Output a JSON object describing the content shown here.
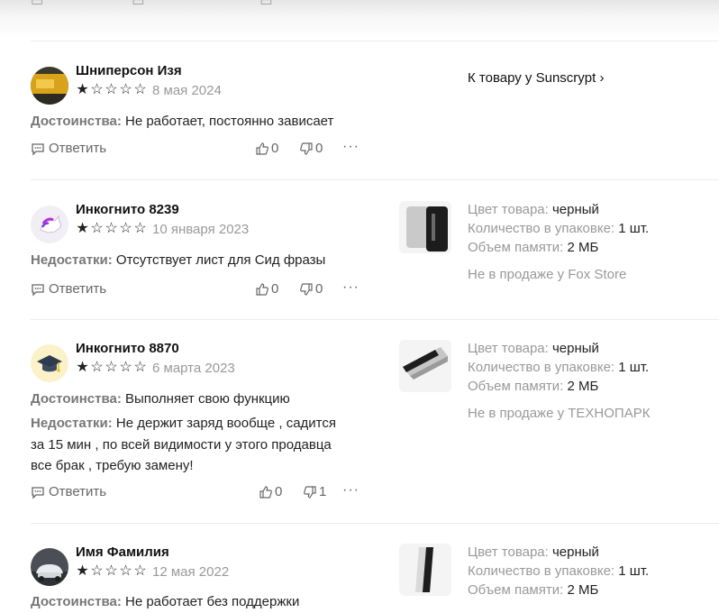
{
  "reviews": [
    {
      "author": "Шниперсон Изя",
      "date": "8 мая 2024",
      "rating": 1,
      "lines": [
        {
          "label": "Достоинства:",
          "text": " Не работает, постоянно зависает"
        }
      ],
      "reply": "Ответить",
      "likes": "0",
      "dislikes": "0",
      "more": "···",
      "product_link": "К товару у Sunscrypt ›"
    },
    {
      "author": "Инкогнито 8239",
      "date": "10 января 2023",
      "rating": 1,
      "lines": [
        {
          "label": "Недостатки:",
          "text": " Отсутствует лист для Сид фразы"
        }
      ],
      "reply": "Ответить",
      "likes": "0",
      "dislikes": "0",
      "more": "···",
      "product": {
        "color_label": "Цвет товара:",
        "color": " черный",
        "qty_label": "Количество в упаковке:",
        "qty": " 1 шт.",
        "mem_label": "Объем памяти:",
        "mem": " 2 МБ",
        "note": "Не в продаже у Fox Store"
      }
    },
    {
      "author": "Инкогнито 8870",
      "date": "6 марта 2023",
      "rating": 1,
      "lines": [
        {
          "label": "Достоинства:",
          "text": " Выполняет свою функцию"
        },
        {
          "label": "Недостатки:",
          "text": " Не держит заряд вообще , садится"
        },
        {
          "label": "",
          "text": "за 15 мин , по всей видимости у этого продавца"
        },
        {
          "label": "",
          "text": "все брак , требую замену!"
        }
      ],
      "reply": "Ответить",
      "likes": "0",
      "dislikes": "1",
      "more": "···",
      "product": {
        "color_label": "Цвет товара:",
        "color": " черный",
        "qty_label": "Количество в упаковке:",
        "qty": " 1 шт.",
        "mem_label": "Объем памяти:",
        "mem": " 2 МБ",
        "note": "Не в продаже у ТЕХНОПАРК"
      }
    },
    {
      "author": "Имя Фамилия",
      "date": "12 мая 2022",
      "rating": 1,
      "lines": [
        {
          "label": "Достоинства:",
          "text": " Не работает без поддержки"
        }
      ],
      "product": {
        "color_label": "Цвет товара:",
        "color": " черный",
        "qty_label": "Количество в упаковке:",
        "qty": " 1 шт.",
        "mem_label": "Объем памяти:",
        "mem": " 2 МБ"
      }
    }
  ]
}
